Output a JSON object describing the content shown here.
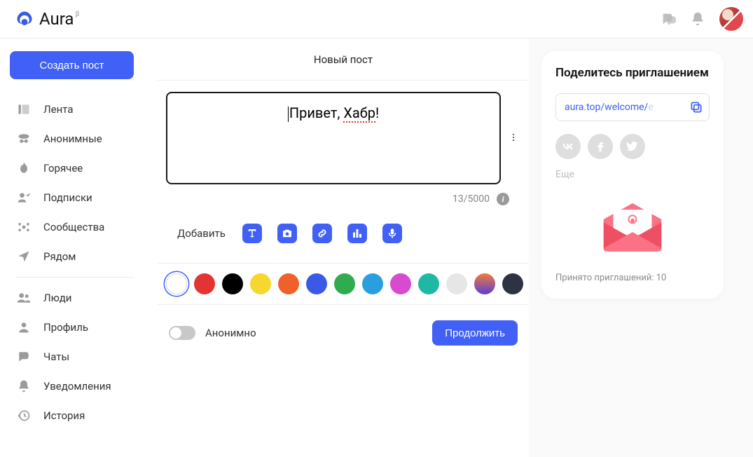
{
  "header": {
    "app_name": "Aura",
    "beta": "β"
  },
  "sidebar": {
    "create_label": "Создать пост",
    "items": [
      {
        "label": "Лента",
        "icon": "feed-icon"
      },
      {
        "label": "Анонимные",
        "icon": "anonymous-icon"
      },
      {
        "label": "Горячее",
        "icon": "flame-icon"
      },
      {
        "label": "Подписки",
        "icon": "subscriptions-icon"
      },
      {
        "label": "Сообщества",
        "icon": "communities-icon"
      },
      {
        "label": "Рядом",
        "icon": "location-icon"
      }
    ],
    "items2": [
      {
        "label": "Люди",
        "icon": "people-icon"
      },
      {
        "label": "Профиль",
        "icon": "profile-icon"
      },
      {
        "label": "Чаты",
        "icon": "chats-icon"
      },
      {
        "label": "Уведомления",
        "icon": "notifications-icon"
      },
      {
        "label": "История",
        "icon": "history-icon"
      }
    ]
  },
  "post": {
    "title": "Новый пост",
    "text_before": "Привет, ",
    "text_red": "Хабр",
    "text_after": "!",
    "counter": "13/5000",
    "add_label": "Добавить",
    "anon_label": "Анонимно",
    "continue_label": "Продолжить",
    "colors": [
      {
        "bg": "#ffffff",
        "selected": true
      },
      {
        "bg": "#e33433"
      },
      {
        "bg": "#000000"
      },
      {
        "bg": "#f7d72f"
      },
      {
        "bg": "#f0612a"
      },
      {
        "bg": "#3959e6"
      },
      {
        "bg": "#2fac4e"
      },
      {
        "bg": "#2a9fe0"
      },
      {
        "bg": "#d84ad0"
      },
      {
        "bg": "#1fb8a4"
      },
      {
        "bg": "#e6e6e6"
      },
      {
        "bg": "linear-gradient(180deg,#f37a3a,#5a3fd6)"
      },
      {
        "bg": "#2d3342"
      }
    ]
  },
  "invite": {
    "title": "Поделитесь приглашением",
    "link_visible": "aura.top/welcome/",
    "link_fade": "e",
    "more_label": "Еще",
    "count_prefix": "Принято приглашений: ",
    "count_value": "10"
  }
}
